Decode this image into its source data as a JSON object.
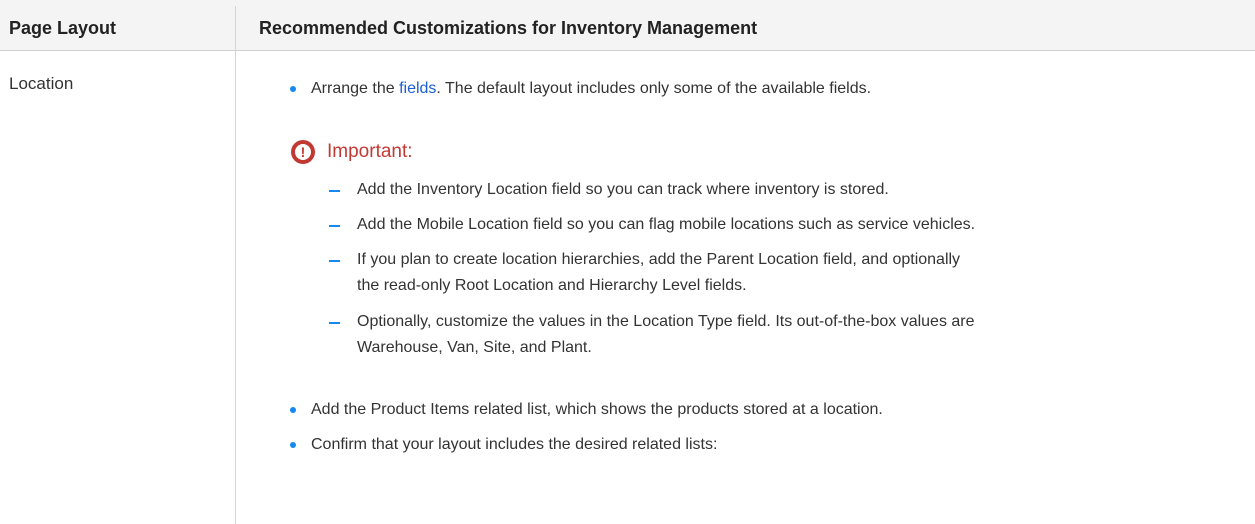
{
  "table": {
    "headers": [
      "Page Layout",
      "Recommended Customizations for Inventory Management"
    ],
    "row": {
      "layout": "Location",
      "bullet1": {
        "before": "Arrange the ",
        "link": "fields",
        "after": ". The default layout includes only some of the available fields."
      },
      "important": {
        "label": "Important:",
        "items": [
          [
            "Add the Inventory Location field so you can track where inventory is stored."
          ],
          [
            "Add the Mobile Location field so you can flag mobile locations such as service vehicles."
          ],
          [
            "If you plan to create location hierarchies, add the Parent Location field, and optionally",
            "the read-only Root Location and Hierarchy Level fields."
          ],
          [
            "Optionally, customize the values in the Location Type field. Its out-of-the-box values are",
            "Warehouse, Van, Site, and Plant."
          ]
        ]
      },
      "bullet2": "Add the Product Items related list, which shows the products stored at a location.",
      "bullet3": "Confirm that your layout includes the desired related lists:"
    }
  },
  "colors": {
    "accent": "#1589ee",
    "important": "#c23934",
    "link": "#1b5fd3"
  },
  "icons": {
    "important": "exclamation-circle-icon"
  }
}
